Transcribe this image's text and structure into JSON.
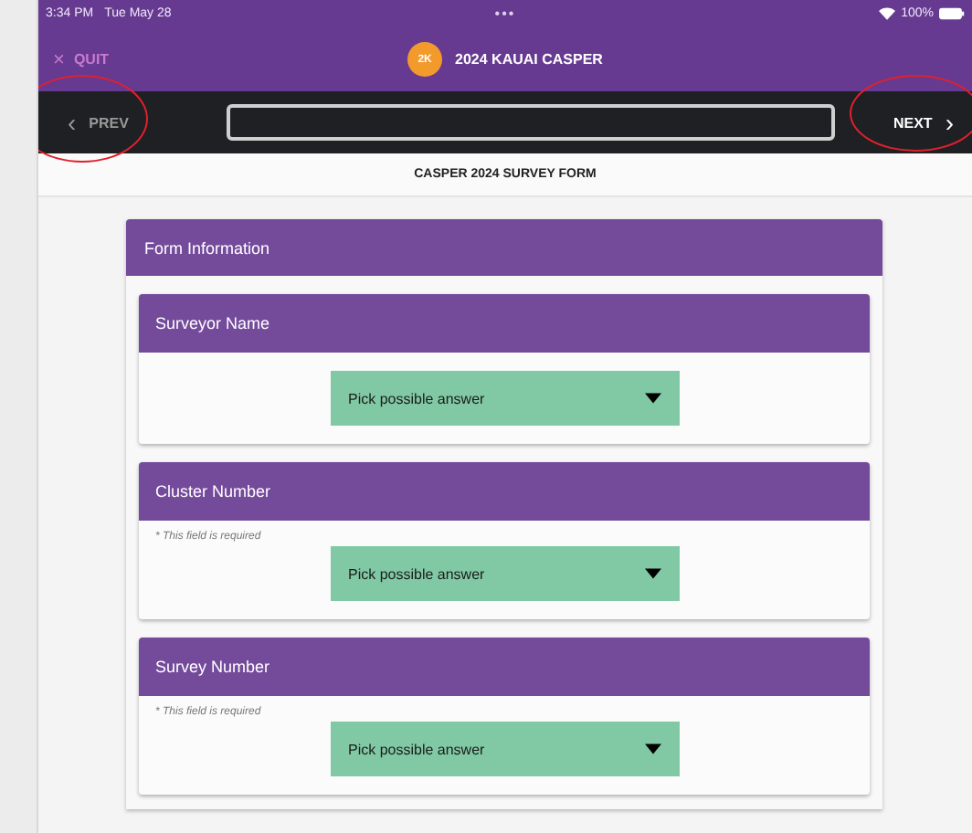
{
  "status_bar": {
    "time": "3:34 PM",
    "date": "Tue May 28",
    "dots": "•••",
    "battery": "100%"
  },
  "title_bar": {
    "quit": {
      "icon": "×",
      "label": "QUIT"
    },
    "badge": "2K",
    "title": "2024 KAUAI CASPER"
  },
  "nav_bar": {
    "prev": {
      "icon": "‹",
      "label": "PREV",
      "circled": true
    },
    "next": {
      "label": "NEXT",
      "icon": "›",
      "circled": true
    }
  },
  "form_title": "CASPER 2024 SURVEY FORM",
  "section": {
    "title": "Form Information",
    "questions": [
      {
        "title": "Surveyor Name",
        "placeholder": "Pick possible answer"
      },
      {
        "title": "Cluster Number",
        "hint": "* This field is required",
        "placeholder": "Pick possible answer"
      },
      {
        "title": "Survey Number",
        "hint": "* This field is required",
        "placeholder": "Pick possible answer"
      }
    ]
  }
}
